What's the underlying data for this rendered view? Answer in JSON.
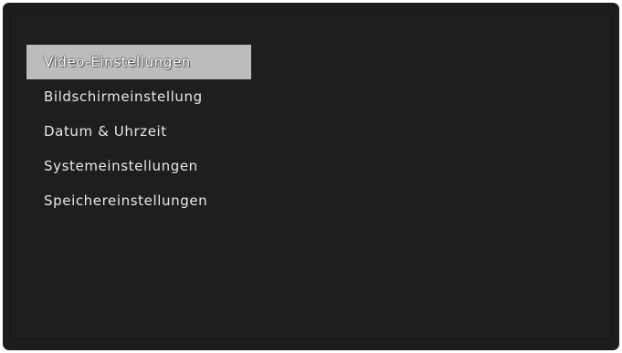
{
  "menu": {
    "selected_index": 0,
    "items": [
      {
        "label": "Video-Einstellungen"
      },
      {
        "label": "Bildschirmeinstellung"
      },
      {
        "label": "Datum & Uhrzeit"
      },
      {
        "label": "Systemeinstellungen"
      },
      {
        "label": "Speichereinstellungen"
      }
    ]
  },
  "colors": {
    "background": "#1c1c1c",
    "selection_highlight": "#bcbcbc",
    "text": "#e8e8e8"
  }
}
